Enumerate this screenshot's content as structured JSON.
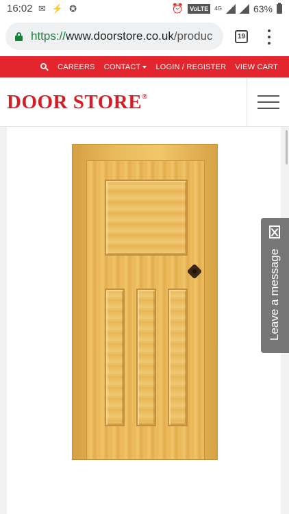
{
  "status_bar": {
    "time": "16:02",
    "volte": "VoLTE",
    "network": "4G",
    "battery": "63%"
  },
  "browser": {
    "url_scheme": "https://",
    "url_host": "www.doorstore.co.uk",
    "url_path": "/produc",
    "tab_count": "19"
  },
  "nav": {
    "items": [
      "CAREERS",
      "CONTACT",
      "LOGIN / REGISTER",
      "VIEW CART"
    ]
  },
  "header": {
    "logo": "DOOR STORE",
    "logo_mark": "®"
  },
  "widget": {
    "leave_message": "Leave a message"
  },
  "colors": {
    "brand_red": "#e3262d",
    "logo_red": "#d41f26",
    "secure_green": "#188038"
  }
}
